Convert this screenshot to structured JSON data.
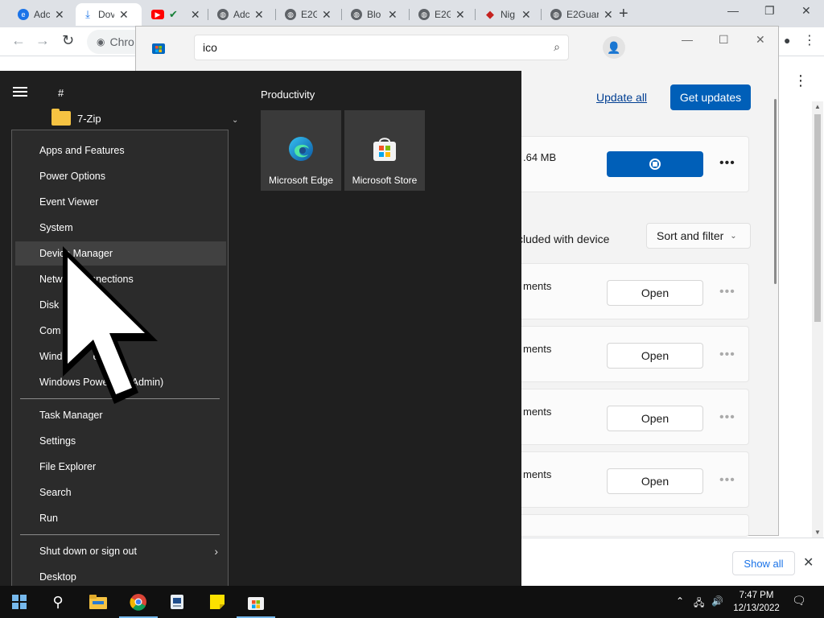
{
  "browser": {
    "tabs": [
      {
        "title": "Adc",
        "icon": "edge-icon",
        "color": "#1a73e8"
      },
      {
        "title": "Dov",
        "icon": "download-icon",
        "color": "#1a73e8",
        "active": true
      },
      {
        "title": "",
        "icon": "youtube-icon",
        "color": "#ff0000"
      },
      {
        "title": "Adc",
        "icon": "globe-icon",
        "color": "#5f6368"
      },
      {
        "title": "E2G",
        "icon": "globe-icon",
        "color": "#5f6368"
      },
      {
        "title": "Blo",
        "icon": "globe-icon",
        "color": "#5f6368"
      },
      {
        "title": "E2G",
        "icon": "globe-icon",
        "color": "#5f6368"
      },
      {
        "title": "Nig",
        "icon": "nightly-icon",
        "color": "#c5221f"
      },
      {
        "title": "E2Guar",
        "icon": "globe-icon",
        "color": "#5f6368"
      }
    ],
    "new_tab": "+",
    "omnibox": "Chro",
    "show_all": "Show all",
    "menu": "⋮"
  },
  "store": {
    "search_value": "ico",
    "update_all": "Update all",
    "get_updates": "Get updates",
    "card_size": ".64 MB",
    "included": "cluded with device",
    "sort_filter": "Sort and filter",
    "rows": [
      {
        "text": "ments",
        "button": "Open"
      },
      {
        "text": "ments",
        "button": "Open"
      },
      {
        "text": "ments",
        "button": "Open"
      },
      {
        "text": "ments",
        "button": "Open"
      }
    ]
  },
  "start": {
    "hash": "#",
    "folder": "7-Zip",
    "group_title": "Productivity",
    "tiles": [
      {
        "label": "Microsoft Edge",
        "icon": "edge-icon"
      },
      {
        "label": "Microsoft Store",
        "icon": "store-icon"
      }
    ]
  },
  "winx_menu": {
    "group1": [
      "Apps and Features",
      "Power Options",
      "Event Viewer",
      "System",
      "Device Manager",
      "Netw          nnections",
      "Disk ",
      "Com",
      "Wind           ell",
      "Windows Power      (Admin)"
    ],
    "group2": [
      "Task Manager",
      "Settings",
      "File Explorer",
      "Search",
      "Run"
    ],
    "group3": [
      "Shut down or sign out",
      "Desktop"
    ],
    "hovered": "Device Manager"
  },
  "taskbar": {
    "time": "7:47 PM",
    "date": "12/13/2022"
  }
}
